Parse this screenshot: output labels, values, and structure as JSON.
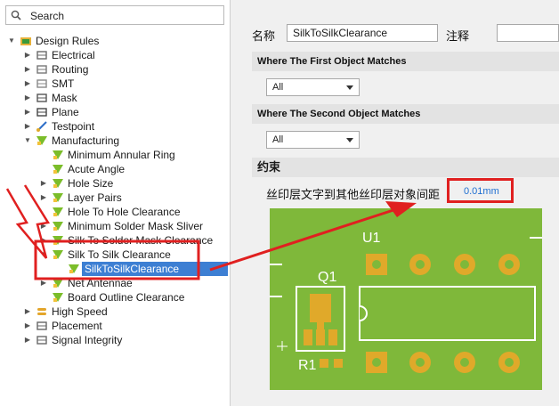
{
  "search": {
    "placeholder": "Search"
  },
  "tree": [
    {
      "label": "Design Rules",
      "icon": "design-rules-icon",
      "arrow": "▼",
      "indent": 0
    },
    {
      "label": "Electrical",
      "icon": "electrical-icon",
      "arrow": "▶",
      "indent": 1
    },
    {
      "label": "Routing",
      "icon": "routing-icon",
      "arrow": "▶",
      "indent": 1
    },
    {
      "label": "SMT",
      "icon": "smt-icon",
      "arrow": "▶",
      "indent": 1
    },
    {
      "label": "Mask",
      "icon": "mask-icon",
      "arrow": "▶",
      "indent": 1
    },
    {
      "label": "Plane",
      "icon": "plane-icon",
      "arrow": "▶",
      "indent": 1
    },
    {
      "label": "Testpoint",
      "icon": "testpoint-icon",
      "arrow": "▶",
      "indent": 1
    },
    {
      "label": "Manufacturing",
      "icon": "manufacturing-icon",
      "arrow": "▼",
      "indent": 1
    },
    {
      "label": "Minimum Annular Ring",
      "icon": "rule-icon",
      "arrow": "",
      "indent": 2
    },
    {
      "label": "Acute Angle",
      "icon": "rule-icon",
      "arrow": "",
      "indent": 2
    },
    {
      "label": "Hole Size",
      "icon": "rule-icon",
      "arrow": "▶",
      "indent": 2
    },
    {
      "label": "Layer Pairs",
      "icon": "rule-icon",
      "arrow": "▶",
      "indent": 2
    },
    {
      "label": "Hole To Hole Clearance",
      "icon": "rule-icon",
      "arrow": "",
      "indent": 2
    },
    {
      "label": "Minimum Solder Mask Sliver",
      "icon": "rule-icon",
      "arrow": "▶",
      "indent": 2
    },
    {
      "label": "Silk To Solder Mask Clearance",
      "icon": "rule-icon",
      "arrow": "▶",
      "indent": 2
    },
    {
      "label": "Silk To Silk Clearance",
      "icon": "rule-icon",
      "arrow": "▼",
      "indent": 2
    },
    {
      "label": "SilkToSilkClearance",
      "icon": "rule-icon",
      "arrow": "",
      "indent": 3,
      "selected": true
    },
    {
      "label": "Net Antennae",
      "icon": "rule-icon",
      "arrow": "▶",
      "indent": 2
    },
    {
      "label": "Board Outline Clearance",
      "icon": "rule-icon",
      "arrow": "",
      "indent": 2
    },
    {
      "label": "High Speed",
      "icon": "high-speed-icon",
      "arrow": "▶",
      "indent": 1
    },
    {
      "label": "Placement",
      "icon": "placement-icon",
      "arrow": "▶",
      "indent": 1
    },
    {
      "label": "Signal Integrity",
      "icon": "signal-integrity-icon",
      "arrow": "▶",
      "indent": 1
    }
  ],
  "rule": {
    "name_label": "名称",
    "name_value": "SilkToSilkClearance",
    "comment_label": "注释",
    "comment_value": ""
  },
  "first_match": {
    "header": "Where The First Object Matches",
    "value": "All"
  },
  "second_match": {
    "header": "Where The Second Object Matches",
    "value": "All"
  },
  "constraints": {
    "header": "约束",
    "desc": "丝印层文字到其他丝印层对象间距",
    "value": "0.01mm",
    "value_color": "#1f6fd1"
  },
  "pcb": {
    "u1": "U1",
    "q1": "Q1",
    "r1": "R1",
    "board_color": "#7fb83a",
    "pad_color": "#e0a92a"
  },
  "annotation_color": "#e02020"
}
